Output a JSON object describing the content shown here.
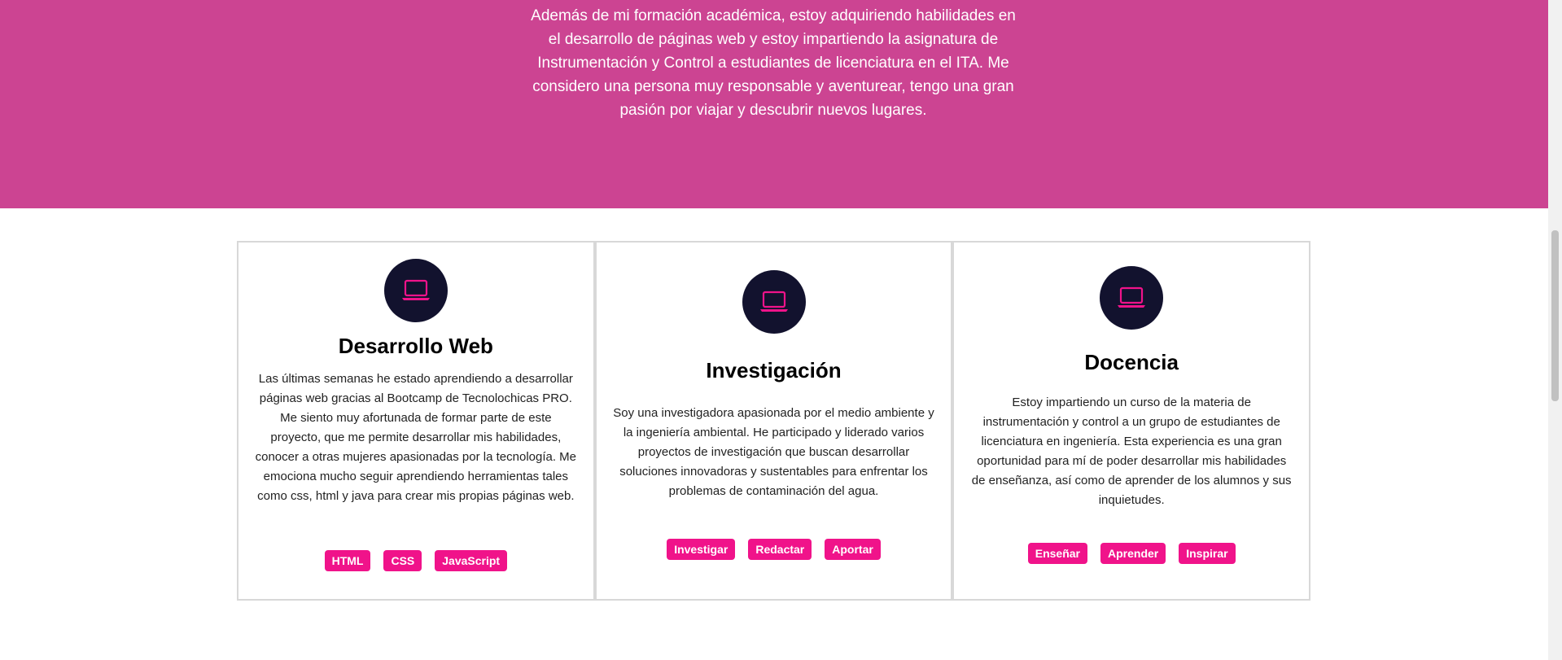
{
  "hero": {
    "top_partial": "",
    "lines": [
      "Además de mi formación académica, estoy adquiriendo habilidades en",
      "el desarrollo de páginas web y estoy impartiendo la asignatura de",
      "Instrumentación y Control a estudiantes de licenciatura en el ITA. Me",
      "considero una persona muy responsable y aventurear, tengo una gran",
      "pasión por viajar y descubrir nuevos lugares."
    ]
  },
  "cards": [
    {
      "title": "Desarrollo Web",
      "icon": "laptop-icon",
      "description": "Las últimas semanas he estado aprendiendo a desarrollar páginas web gracias al Bootcamp de Tecnolochicas PRO. Me siento muy afortunada de formar parte de este proyecto, que me permite desarrollar mis habilidades, conocer a otras mujeres apasionadas por la tecnología. Me emociona mucho seguir aprendiendo herramientas tales como css, html y java para crear mis propias páginas web.",
      "tags": [
        "HTML",
        "CSS",
        "JavaScript"
      ]
    },
    {
      "title": "Investigación",
      "icon": "laptop-icon",
      "description": "Soy una investigadora apasionada por el medio ambiente y la ingeniería ambiental. He participado y liderado varios proyectos de investigación que buscan desarrollar soluciones innovadoras y sustentables para enfrentar los problemas de contaminación del agua.",
      "tags": [
        "Investigar",
        "Redactar",
        "Aportar"
      ]
    },
    {
      "title": "Docencia",
      "icon": "laptop-icon",
      "description": "Estoy impartiendo un curso de la materia de instrumentación y control a un grupo de estudiantes de licenciatura en ingeniería. Esta experiencia es una gran oportunidad para mí de poder desarrollar mis habilidades de enseñanza, así como de aprender de los alumnos y sus inquietudes.",
      "tags": [
        "Enseñar",
        "Aprender",
        "Inspirar"
      ]
    }
  ],
  "colors": {
    "hero_bg": "#cc4492",
    "icon_bg": "#12122e",
    "accent": "#f0138a"
  }
}
